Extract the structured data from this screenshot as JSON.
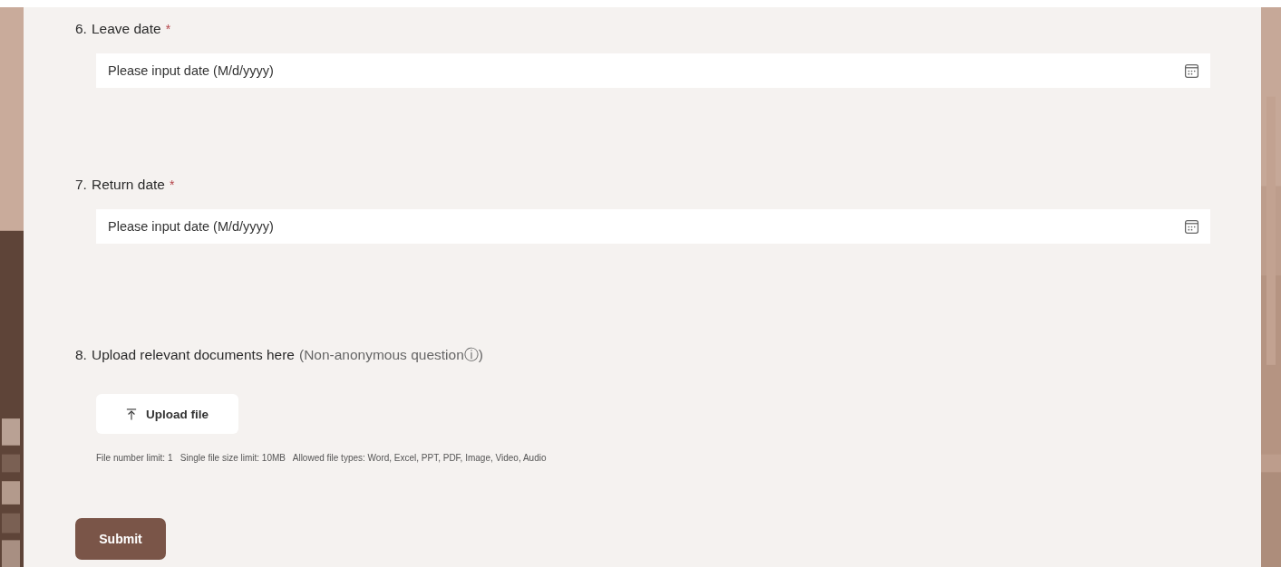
{
  "questions": [
    {
      "kind": "date",
      "number": "6.",
      "title": "Leave date",
      "required_mark": "*",
      "placeholder": "Please input date (M/d/yyyy)"
    },
    {
      "kind": "date",
      "number": "7.",
      "title": "Return date",
      "required_mark": "*",
      "placeholder": "Please input date (M/d/yyyy)"
    },
    {
      "kind": "upload",
      "number": "8.",
      "title": "Upload relevant documents here",
      "note": "(Non-anonymous questionⓘ)",
      "button": "Upload file",
      "limits": "File number limit: 1   Single file size limit: 10MB   Allowed file types: Word, Excel, PPT, PDF, Image, Video, Audio"
    }
  ],
  "submit": "Submit"
}
